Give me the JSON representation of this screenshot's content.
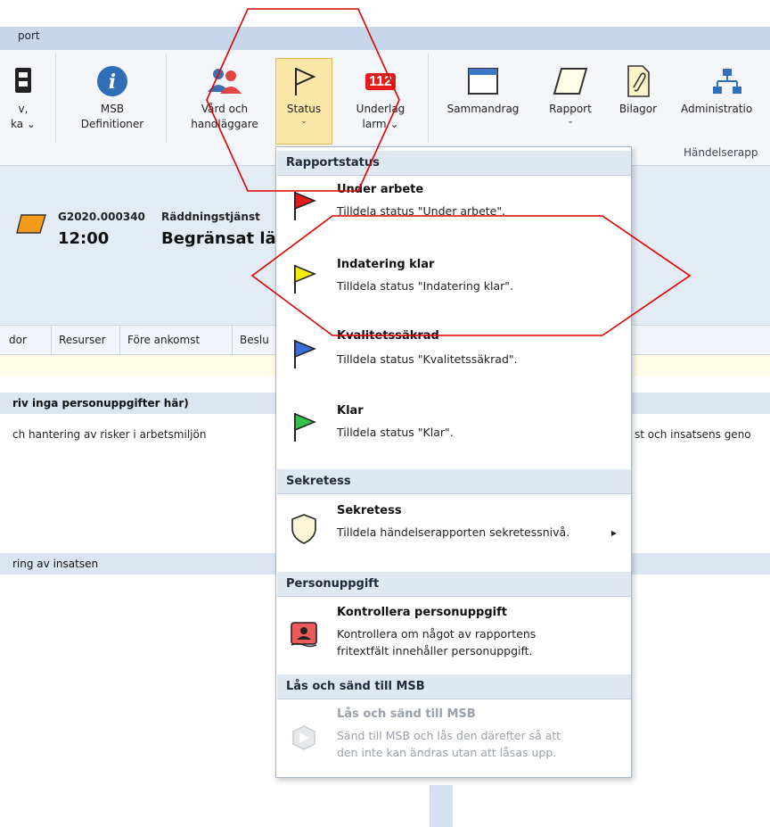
{
  "window": {
    "title_fragment": "port"
  },
  "ribbon": {
    "buttons": [
      {
        "label1": "v,",
        "label2": "ka",
        "has_arrow": true
      },
      {
        "label1": "MSB",
        "label2": "Definitioner"
      },
      {
        "label1": "Vård och",
        "label2": "handläggare"
      },
      {
        "label1": "Status",
        "has_arrow": true
      },
      {
        "badge": "112",
        "label1": "Underlag",
        "label2": "larm",
        "has_arrow": true
      },
      {
        "label1": "Sammandrag"
      },
      {
        "label1": "Rapport",
        "has_arrow": true
      },
      {
        "label1": "Bilagor"
      },
      {
        "label1": "Administratio"
      }
    ],
    "group_caption": "Händelserapp",
    "arrow_glyph": "⌄"
  },
  "record": {
    "id": "G2020.000340",
    "type": "Räddningstjänst",
    "time": "12:00",
    "title": "Begränsat lä"
  },
  "tabs": [
    "dor",
    "Resurser",
    "Före ankomst",
    "Beslu"
  ],
  "sections": {
    "privacy_note": "riv inga personuppgifter här)",
    "risk_line": "ch hantering av risker i arbetsmiljön",
    "right_line": "st och insatsens geno",
    "evaluation": "ring av insatsen"
  },
  "menu": {
    "group_status": "Rapportstatus",
    "items": [
      {
        "title": "Under arbete",
        "desc": "Tilldela status \"Under arbete\".",
        "flag_color": "#e01b1b"
      },
      {
        "title": "Indatering klar",
        "desc": "Tilldela status \"Indatering klar\".",
        "flag_color": "#f2ea0a"
      },
      {
        "title": "Kvalitetssäkrad",
        "desc": "Tilldela status \"Kvalitetssäkrad\".",
        "flag_color": "#3b6fd6"
      },
      {
        "title": "Klar",
        "desc": "Tilldela status \"Klar\".",
        "flag_color": "#33c24d"
      }
    ],
    "group_secrecy": "Sekretess",
    "secrecy": {
      "title": "Sekretess",
      "desc": "Tilldela händelserapporten sekretessnivå."
    },
    "group_personal": "Personuppgift",
    "personal": {
      "title": "Kontrollera personuppgift",
      "desc1": "Kontrollera om något av rapportens",
      "desc2": "fritextfält innehåller personuppgift."
    },
    "group_lock": "Lås och sänd till MSB",
    "lock": {
      "title": "Lås och sänd till MSB",
      "desc1": "Sänd till MSB och lås den därefter så att",
      "desc2": "den inte kan ändras utan att låsas upp."
    }
  },
  "colors": {
    "ribbon_bg": "#f4f6f9",
    "active_button": "#fbe7a8",
    "annotation": "#e00000",
    "menu_header": "#dfe7f1"
  }
}
